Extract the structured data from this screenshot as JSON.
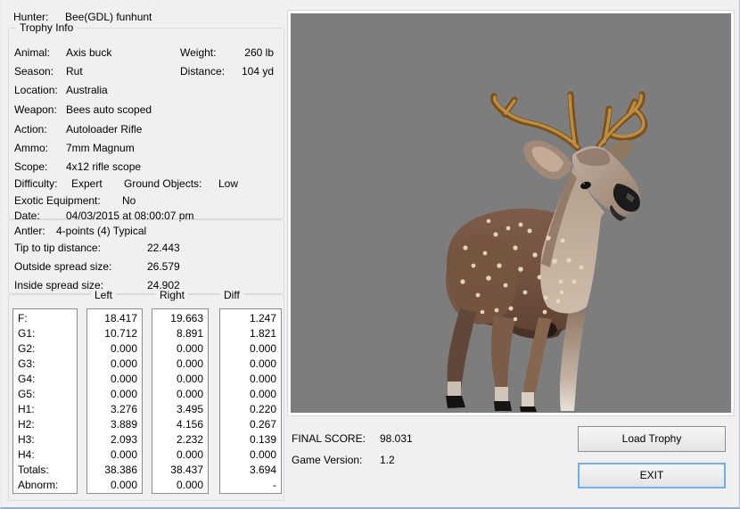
{
  "hunter": {
    "label": "Hunter:",
    "value": "Bee(GDL) funhunt"
  },
  "trophy_info": {
    "title": "Trophy Info",
    "animal": {
      "label": "Animal:",
      "value": "Axis buck"
    },
    "weight": {
      "label": "Weight:",
      "value": "260 lb"
    },
    "season": {
      "label": "Season:",
      "value": "Rut"
    },
    "distance": {
      "label": "Distance:",
      "value": "104 yd"
    },
    "location": {
      "label": "Location:",
      "value": "Australia"
    },
    "weapon": {
      "label": "Weapon:",
      "value": "Bees auto scoped"
    },
    "action": {
      "label": "Action:",
      "value": "Autoloader Rifle"
    },
    "ammo": {
      "label": "Ammo:",
      "value": "7mm Magnum"
    },
    "scope": {
      "label": "Scope:",
      "value": "4x12 rifle scope"
    },
    "difficulty": {
      "label": "Difficulty:",
      "value": "Expert"
    },
    "ground_objects": {
      "label": "Ground Objects:",
      "value": "Low"
    },
    "exotic_equipment": {
      "label": "Exotic Equipment:",
      "value": "No"
    },
    "date": {
      "label": "Date:",
      "value": "04/03/2015 at 08:00:07 pm"
    }
  },
  "antler_info": {
    "antler": {
      "label": "Antler:",
      "value": "4-points (4) Typical"
    },
    "measurements": [
      {
        "label": "Tip to tip distance:",
        "value": "22.443"
      },
      {
        "label": "Outside spread size:",
        "value": "26.579"
      },
      {
        "label": "Inside spread size:",
        "value": "24.902"
      }
    ]
  },
  "score_table": {
    "columns": [
      "Left",
      "Right",
      "Diff"
    ],
    "rows": [
      {
        "label": "F:",
        "left": "18.417",
        "right": "19.663",
        "diff": "1.247"
      },
      {
        "label": "G1:",
        "left": "10.712",
        "right": "8.891",
        "diff": "1.821"
      },
      {
        "label": "G2:",
        "left": "0.000",
        "right": "0.000",
        "diff": "0.000"
      },
      {
        "label": "G3:",
        "left": "0.000",
        "right": "0.000",
        "diff": "0.000"
      },
      {
        "label": "G4:",
        "left": "0.000",
        "right": "0.000",
        "diff": "0.000"
      },
      {
        "label": "G5:",
        "left": "0.000",
        "right": "0.000",
        "diff": "0.000"
      },
      {
        "label": "H1:",
        "left": "3.276",
        "right": "3.495",
        "diff": "0.220"
      },
      {
        "label": "H2:",
        "left": "3.889",
        "right": "4.156",
        "diff": "0.267"
      },
      {
        "label": "H3:",
        "left": "2.093",
        "right": "2.232",
        "diff": "0.139"
      },
      {
        "label": "H4:",
        "left": "0.000",
        "right": "0.000",
        "diff": "0.000"
      },
      {
        "label": "Totals:",
        "left": "38.386",
        "right": "38.437",
        "diff": "3.694"
      },
      {
        "label": "Abnorm:",
        "left": "0.000",
        "right": "0.000",
        "diff": "-"
      }
    ]
  },
  "footer": {
    "final_score_label": "FINAL SCORE:",
    "final_score_value": "98.031",
    "game_version_label": "Game Version:",
    "game_version_value": "1.2",
    "load_trophy_button": "Load Trophy",
    "exit_button": "EXIT"
  },
  "colors": {
    "dialog_background": "#f0f0f0",
    "image_background": "#7d7d7d",
    "focus_border_blue": "#74aee2",
    "listbox_border": "#898c95",
    "groupbox_border": "#d9dadc"
  }
}
